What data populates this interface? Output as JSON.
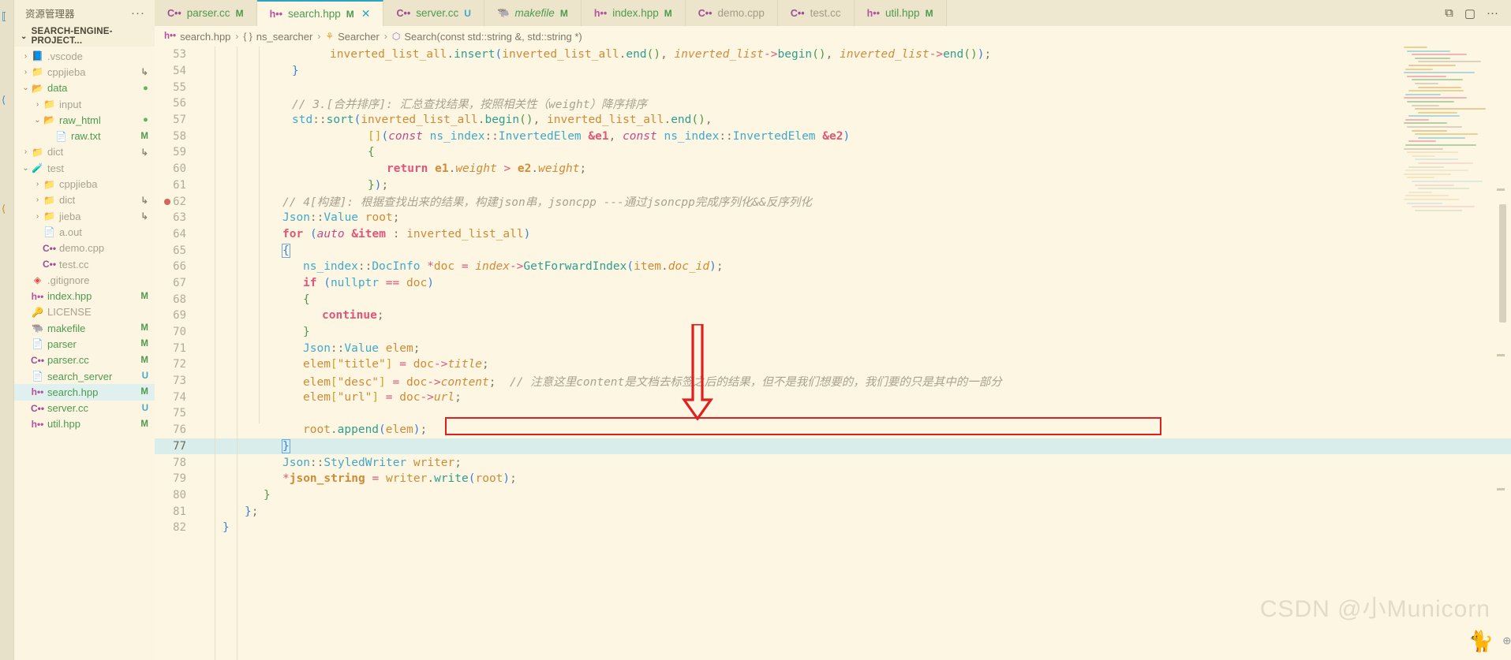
{
  "window": {
    "explorer_title": "资源管理器",
    "explorer_more": "···",
    "project_title": "SEARCH-ENGINE-PROJECT...",
    "actions": [
      "⧉",
      "▢",
      "···"
    ]
  },
  "tabs": [
    {
      "icon": "cpp-icon",
      "icon_label": "C••",
      "name": "parser.cc",
      "badge": "M",
      "state": "inactive",
      "italic": false,
      "dim": false
    },
    {
      "icon": "hpp-icon",
      "icon_label": "h••",
      "name": "search.hpp",
      "badge": "M",
      "state": "active",
      "italic": false,
      "dim": false,
      "close": "✕"
    },
    {
      "icon": "cpp-icon",
      "icon_label": "C••",
      "name": "server.cc",
      "badge": "U",
      "state": "inactive",
      "italic": false,
      "dim": false
    },
    {
      "icon": "gnu-icon",
      "icon_label": "🐃",
      "name": "makefile",
      "badge": "M",
      "state": "inactive",
      "italic": true,
      "dim": false
    },
    {
      "icon": "hpp-icon",
      "icon_label": "h••",
      "name": "index.hpp",
      "badge": "M",
      "state": "inactive",
      "italic": false,
      "dim": false
    },
    {
      "icon": "cpp-icon",
      "icon_label": "C••",
      "name": "demo.cpp",
      "badge": "",
      "state": "inactive",
      "italic": false,
      "dim": true
    },
    {
      "icon": "cpp-icon",
      "icon_label": "C••",
      "name": "test.cc",
      "badge": "",
      "state": "inactive",
      "italic": false,
      "dim": true
    },
    {
      "icon": "hpp-icon",
      "icon_label": "h••",
      "name": "util.hpp",
      "badge": "M",
      "state": "inactive",
      "italic": false,
      "dim": false
    }
  ],
  "breadcrumb": [
    {
      "icon": "hpp-icon",
      "icon_label": "h••",
      "label": "search.hpp"
    },
    {
      "icon": "namespace-icon",
      "icon_label": "{ }",
      "label": "ns_searcher"
    },
    {
      "icon": "class-icon",
      "icon_label": "⚘",
      "label": "Searcher"
    },
    {
      "icon": "method-icon",
      "icon_label": "⬡",
      "label": "Search(const std::string &, std::string *)"
    }
  ],
  "sidebar": [
    {
      "indent": 0,
      "arrow": "›",
      "icon": "vscode-folder-icon",
      "glyph": "📘",
      "name": ".vscode",
      "name_color": "grey",
      "suffix": "",
      "suffix_type": ""
    },
    {
      "indent": 0,
      "arrow": "›",
      "icon": "folder-icon",
      "glyph": "📁",
      "name": "cppjieba",
      "name_color": "grey",
      "suffix": "↳",
      "suffix_type": "link"
    },
    {
      "indent": 0,
      "arrow": "⌄",
      "icon": "folder-open-icon",
      "glyph": "📂",
      "name": "data",
      "name_color": "green",
      "suffix": "●",
      "suffix_type": "dot"
    },
    {
      "indent": 1,
      "arrow": "›",
      "icon": "folder-icon",
      "glyph": "📁",
      "name": "input",
      "name_color": "grey",
      "suffix": "",
      "suffix_type": ""
    },
    {
      "indent": 1,
      "arrow": "⌄",
      "icon": "folder-open-icon",
      "glyph": "📂",
      "name": "raw_html",
      "name_color": "green",
      "suffix": "●",
      "suffix_type": "dot"
    },
    {
      "indent": 2,
      "arrow": "",
      "icon": "text-file-icon",
      "glyph": "📄",
      "name": "raw.txt",
      "name_color": "green",
      "suffix": "M",
      "suffix_type": "mod"
    },
    {
      "indent": 0,
      "arrow": "›",
      "icon": "folder-icon",
      "glyph": "📁",
      "name": "dict",
      "name_color": "grey",
      "suffix": "↳",
      "suffix_type": "link"
    },
    {
      "indent": 0,
      "arrow": "⌄",
      "icon": "test-folder-icon",
      "glyph": "🧪",
      "name": "test",
      "name_color": "grey",
      "suffix": "",
      "suffix_type": ""
    },
    {
      "indent": 1,
      "arrow": "›",
      "icon": "folder-icon",
      "glyph": "📁",
      "name": "cppjieba",
      "name_color": "grey",
      "suffix": "",
      "suffix_type": ""
    },
    {
      "indent": 1,
      "arrow": "›",
      "icon": "folder-icon",
      "glyph": "📁",
      "name": "dict",
      "name_color": "grey",
      "suffix": "↳",
      "suffix_type": "link"
    },
    {
      "indent": 1,
      "arrow": "›",
      "icon": "folder-icon",
      "glyph": "📁",
      "name": "jieba",
      "name_color": "grey",
      "suffix": "↳",
      "suffix_type": "link"
    },
    {
      "indent": 1,
      "arrow": "",
      "icon": "file-icon",
      "glyph": "📄",
      "name": "a.out",
      "name_color": "grey",
      "suffix": "",
      "suffix_type": ""
    },
    {
      "indent": 1,
      "arrow": "",
      "icon": "cpp-icon",
      "glyph": "C••",
      "name": "demo.cpp",
      "name_color": "grey",
      "suffix": "",
      "suffix_type": ""
    },
    {
      "indent": 1,
      "arrow": "",
      "icon": "cpp-icon",
      "glyph": "C••",
      "name": "test.cc",
      "name_color": "grey",
      "suffix": "",
      "suffix_type": ""
    },
    {
      "indent": 0,
      "arrow": "",
      "icon": "git-icon",
      "glyph": "◈",
      "name": ".gitignore",
      "name_color": "grey",
      "suffix": "",
      "suffix_type": ""
    },
    {
      "indent": 0,
      "arrow": "",
      "icon": "hpp-icon",
      "glyph": "h••",
      "name": "index.hpp",
      "name_color": "green",
      "suffix": "M",
      "suffix_type": "mod"
    },
    {
      "indent": 0,
      "arrow": "",
      "icon": "license-icon",
      "glyph": "🔑",
      "name": "LICENSE",
      "name_color": "grey",
      "suffix": "",
      "suffix_type": ""
    },
    {
      "indent": 0,
      "arrow": "",
      "icon": "gnu-icon",
      "glyph": "🐃",
      "name": "makefile",
      "name_color": "green",
      "suffix": "M",
      "suffix_type": "mod"
    },
    {
      "indent": 0,
      "arrow": "",
      "icon": "file-icon",
      "glyph": "📄",
      "name": "parser",
      "name_color": "green",
      "suffix": "M",
      "suffix_type": "mod"
    },
    {
      "indent": 0,
      "arrow": "",
      "icon": "cpp-icon",
      "glyph": "C••",
      "name": "parser.cc",
      "name_color": "green",
      "suffix": "M",
      "suffix_type": "mod"
    },
    {
      "indent": 0,
      "arrow": "",
      "icon": "file-icon",
      "glyph": "📄",
      "name": "search_server",
      "name_color": "green",
      "suffix": "U",
      "suffix_type": "untracked"
    },
    {
      "indent": 0,
      "arrow": "",
      "icon": "hpp-icon",
      "glyph": "h••",
      "name": "search.hpp",
      "name_color": "green",
      "suffix": "M",
      "suffix_type": "mod",
      "selected": true
    },
    {
      "indent": 0,
      "arrow": "",
      "icon": "cpp-icon",
      "glyph": "C••",
      "name": "server.cc",
      "name_color": "green",
      "suffix": "U",
      "suffix_type": "untracked"
    },
    {
      "indent": 0,
      "arrow": "",
      "icon": "hpp-icon",
      "glyph": "h••",
      "name": "util.hpp",
      "name_color": "green",
      "suffix": "M",
      "suffix_type": "mod"
    }
  ],
  "editor": {
    "first_line": 53,
    "current_line": 77,
    "breakpoint_line": 62,
    "lines": [
      {
        "n": 53,
        "html": "<span class='t-plain' style='padding-left:164px'></span><span class='t-var'>inverted_list_all</span><span class='t-punc'>.</span><span class='t-fn'>insert</span><span class='t-paren'>(</span><span class='t-var'>inverted_list_all</span><span class='t-punc'>.</span><span class='t-fn'>end</span><span class='t-paren2'>()</span><span class='t-punc'>, </span><span class='t-var2'>inverted_list</span><span class='t-op'>-&gt;</span><span class='t-fn'>begin</span><span class='t-paren2'>()</span><span class='t-punc'>, </span><span class='t-var2'>inverted_list</span><span class='t-op'>-&gt;</span><span class='t-fn'>end</span><span class='t-paren2'>()</span><span class='t-paren'>)</span><span class='t-punc'>;</span>"
      },
      {
        "n": 54,
        "html": "<span style='padding-left:116px'></span><span class='t-paren'>}</span>"
      },
      {
        "n": 55,
        "html": ""
      },
      {
        "n": 56,
        "html": "<span style='padding-left:116px'></span><span class='t-cmt'>// 3.[合并排序]: 汇总查找结果，按照相关性（weight）降序排序</span>"
      },
      {
        "n": 57,
        "html": "<span style='padding-left:116px'></span><span class='t-ns'>std</span><span class='t-punc'>::</span><span class='t-fn'>sort</span><span class='t-paren'>(</span><span class='t-var'>inverted_list_all</span><span class='t-punc'>.</span><span class='t-fn'>begin</span><span class='t-paren2'>()</span><span class='t-punc'>, </span><span class='t-var'>inverted_list_all</span><span class='t-punc'>.</span><span class='t-fn'>end</span><span class='t-paren2'>()</span><span class='t-punc'>,</span>"
      },
      {
        "n": 58,
        "html": "<span style='padding-left:212px'></span><span class='t-paren3'>[]</span><span class='t-paren'>(</span><span class='t-kw2'>const</span> <span class='t-ns'>ns_index</span><span class='t-punc'>::</span><span class='t-type'>InvertedElem</span> <span class='t-red t-bold'>&amp;e1</span><span class='t-punc'>, </span><span class='t-kw2'>const</span> <span class='t-ns'>ns_index</span><span class='t-punc'>::</span><span class='t-type'>InvertedElem</span> <span class='t-red t-bold'>&amp;e2</span><span class='t-paren'>)</span>"
      },
      {
        "n": 59,
        "html": "<span style='padding-left:212px'></span><span class='t-paren2'>{</span>"
      },
      {
        "n": 60,
        "html": "<span style='padding-left:236px'></span><span class='t-kw'>return</span> <span class='t-bold t-var'>e1</span><span class='t-punc'>.</span><span class='t-member'>weight</span> <span class='t-op'>&gt;</span> <span class='t-bold t-var'>e2</span><span class='t-punc'>.</span><span class='t-member'>weight</span><span class='t-punc'>;</span>"
      },
      {
        "n": 61,
        "html": "<span style='padding-left:212px'></span><span class='t-paren2'>}</span><span class='t-paren'>)</span><span class='t-punc'>;</span>"
      },
      {
        "n": 62,
        "html": "<span style='padding-left:104px'></span><span class='t-cmt'>// 4[构建]: 根据查找出来的结果，构建json串，jsoncpp ---通过jsoncpp完成序列化&amp;&amp;反序列化</span>"
      },
      {
        "n": 63,
        "html": "<span style='padding-left:104px'></span><span class='t-ns'>Json</span><span class='t-punc'>::</span><span class='t-type'>Value</span> <span class='t-var'>root</span><span class='t-punc'>;</span>"
      },
      {
        "n": 64,
        "html": "<span style='padding-left:104px'></span><span class='t-kw'>for</span> <span class='t-paren'>(</span><span class='t-kw2'>auto</span> <span class='t-red t-bold'>&amp;item</span> <span class='t-punc'>: </span><span class='t-var'>inverted_list_all</span><span class='t-paren'>)</span>"
      },
      {
        "n": 65,
        "html": "<span style='padding-left:104px'></span><span class='t-paren' style='outline:1px solid #6aa7e0;'>{</span>"
      },
      {
        "n": 66,
        "html": "<span style='padding-left:130px'></span><span class='t-ns'>ns_index</span><span class='t-punc'>::</span><span class='t-type'>DocInfo</span> <span class='t-op'>*</span><span class='t-var'>doc</span> <span class='t-op'>=</span> <span class='t-var2'>index</span><span class='t-op'>-&gt;</span><span class='t-fn'>GetForwardIndex</span><span class='t-paren'>(</span><span class='t-var'>item</span><span class='t-punc'>.</span><span class='t-member'>doc_id</span><span class='t-paren'>)</span><span class='t-punc'>;</span>"
      },
      {
        "n": 67,
        "html": "<span style='padding-left:130px'></span><span class='t-kw'>if</span> <span class='t-paren'>(</span><span class='t-type'>nullptr</span> <span class='t-op'>==</span> <span class='t-var'>doc</span><span class='t-paren'>)</span>"
      },
      {
        "n": 68,
        "html": "<span style='padding-left:130px'></span><span class='t-paren2'>{</span>"
      },
      {
        "n": 69,
        "html": "<span style='padding-left:154px'></span><span class='t-kw'>continue</span><span class='t-punc'>;</span>"
      },
      {
        "n": 70,
        "html": "<span style='padding-left:130px'></span><span class='t-paren2'>}</span>"
      },
      {
        "n": 71,
        "html": "<span style='padding-left:130px'></span><span class='t-ns'>Json</span><span class='t-punc'>::</span><span class='t-type'>Value</span> <span class='t-var'>elem</span><span class='t-punc'>;</span>"
      },
      {
        "n": 72,
        "html": "<span style='padding-left:130px'></span><span class='t-var'>elem</span><span class='t-paren3'>[</span><span class='t-str'>\"title\"</span><span class='t-paren3'>]</span> <span class='t-op'>=</span> <span class='t-var'>doc</span><span class='t-op'>-&gt;</span><span class='t-member'>title</span><span class='t-punc'>;</span>"
      },
      {
        "n": 73,
        "html": "<span style='padding-left:130px'></span><span class='t-var'>elem</span><span class='t-paren3'>[</span><span class='t-str'>\"desc\"</span><span class='t-paren3'>]</span> <span class='t-op'>=</span> <span class='t-var'>doc</span><span class='t-op'>-&gt;</span><span class='t-member'>content</span><span class='t-punc'>;</span>  <span class='t-cmt'>// 注意这里content是文档去标签之后的结果，但不是我们想要的，我们要的只是其中的一部分</span>"
      },
      {
        "n": 74,
        "html": "<span style='padding-left:130px'></span><span class='t-var'>elem</span><span class='t-paren3'>[</span><span class='t-str'>\"url\"</span><span class='t-paren3'>]</span> <span class='t-op'>=</span> <span class='t-var'>doc</span><span class='t-op'>-&gt;</span><span class='t-member'>url</span><span class='t-punc'>;</span>"
      },
      {
        "n": 75,
        "html": ""
      },
      {
        "n": 76,
        "html": "<span style='padding-left:130px'></span><span class='t-var'>root</span><span class='t-punc'>.</span><span class='t-fn'>append</span><span class='t-paren'>(</span><span class='t-var'>elem</span><span class='t-paren'>)</span><span class='t-punc'>;</span>"
      },
      {
        "n": 77,
        "html": "<span style='padding-left:104px'></span><span class='t-paren' style='outline:1px solid #6aa7e0;'>}</span>"
      },
      {
        "n": 78,
        "html": "<span style='padding-left:104px'></span><span class='t-ns'>Json</span><span class='t-punc'>::</span><span class='t-type'>StyledWriter</span> <span class='t-var'>writer</span><span class='t-punc'>;</span>"
      },
      {
        "n": 79,
        "html": "<span style='padding-left:104px'></span><span class='t-op'>*</span><span class='t-bold t-var'>json_string</span> <span class='t-op'>=</span> <span class='t-var'>writer</span><span class='t-punc'>.</span><span class='t-fn'>write</span><span class='t-paren'>(</span><span class='t-var'>root</span><span class='t-paren'>)</span><span class='t-punc'>;</span>"
      },
      {
        "n": 80,
        "html": "<span style='padding-left:80px'></span><span class='t-paren2'>}</span>"
      },
      {
        "n": 81,
        "html": "<span style='padding-left:56px'></span><span class='t-paren'>}</span><span class='t-punc'>;</span>"
      },
      {
        "n": 82,
        "html": "<span style='padding-left:28px'></span><span class='t-paren'>}</span>"
      }
    ]
  },
  "annotations": {
    "highlight_box_color": "#e02020",
    "arrow_color": "#e02020",
    "arrow_points_to_line": 73
  },
  "watermark": {
    "text": "CSDN @小Municorn"
  }
}
